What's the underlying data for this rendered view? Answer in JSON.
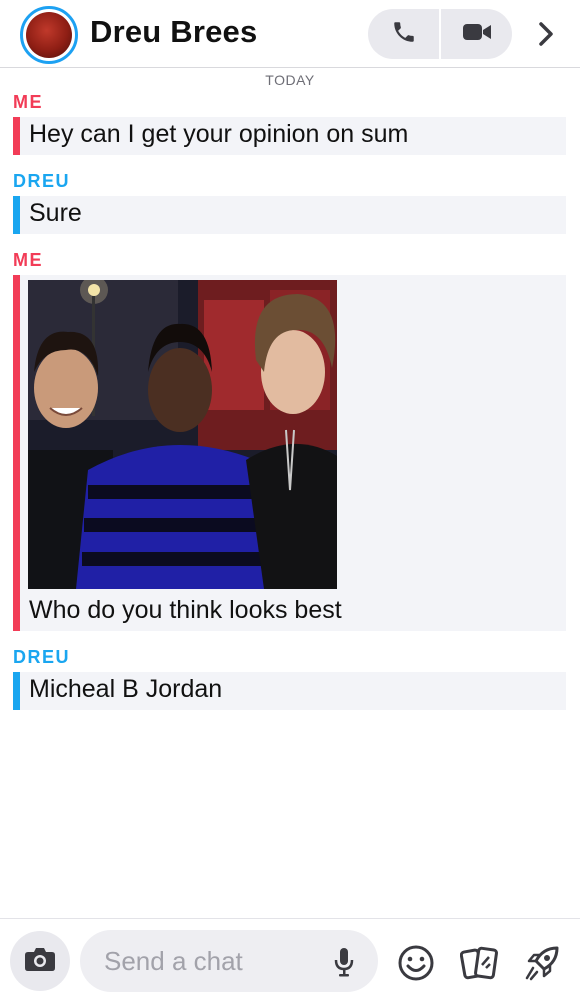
{
  "header": {
    "contact_name": "Dreu Brees",
    "icons": [
      "avatar",
      "phone-icon",
      "video-icon",
      "chevron-right-icon"
    ],
    "ring_color": "#1da1f2"
  },
  "chat": {
    "date_divider": "TODAY",
    "colors": {
      "me": "#f23c57",
      "dreu": "#1aa6f0",
      "bubble_bg": "#f3f4f8"
    },
    "messages": [
      {
        "sender": "ME",
        "text": "Hey can I get your opinion on sum"
      },
      {
        "sender": "DREU",
        "text": "Sure"
      },
      {
        "sender": "ME",
        "text": "Who do you think looks best",
        "attachment": "photo of three men"
      },
      {
        "sender": "DREU",
        "text": "Micheal B Jordan"
      }
    ]
  },
  "composer": {
    "placeholder": "Send a chat",
    "icons": [
      "camera-icon",
      "microphone-icon",
      "emoji-icon",
      "cards-icon",
      "rocket-icon"
    ]
  }
}
